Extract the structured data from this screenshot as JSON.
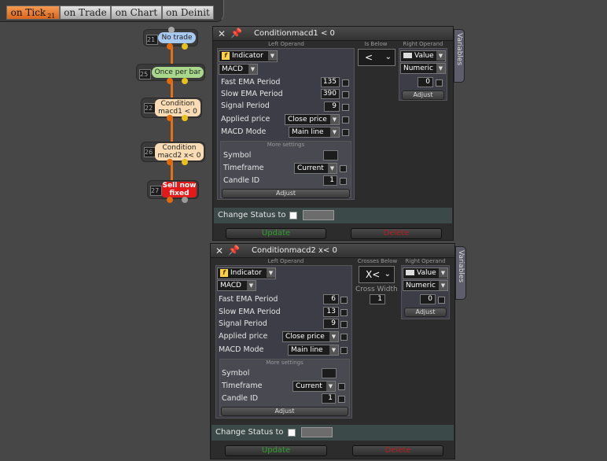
{
  "tabs": [
    {
      "label": "on Tick",
      "sub": "21"
    },
    {
      "label": "on Trade"
    },
    {
      "label": "on Chart"
    },
    {
      "label": "on Deinit"
    }
  ],
  "nodes": [
    {
      "num": "21",
      "label": "No trade"
    },
    {
      "num": "25",
      "label": "Once per bar"
    },
    {
      "num": "22",
      "label": "Condition macd1 < 0"
    },
    {
      "num": "26",
      "label": "Condition macd2 x< 0"
    },
    {
      "num": "27",
      "label": "Sell now fixed"
    }
  ],
  "panel1": {
    "title": "Conditionmacd1 < 0",
    "variables": "Variables",
    "left_operand": "Left Operand",
    "indicator_type": "Indicator",
    "indicator": "MACD",
    "params": [
      {
        "label": "Fast EMA Period",
        "value": "135"
      },
      {
        "label": "Slow EMA Period",
        "value": "390"
      },
      {
        "label": "Signal Period",
        "value": "9"
      }
    ],
    "applied_price_label": "Applied price",
    "applied_price": "Close price",
    "mode_label": "MACD Mode",
    "mode": "Main line",
    "more": "More settings",
    "symbol_label": "Symbol",
    "timeframe_label": "Timeframe",
    "timeframe": "Current",
    "candle_label": "Candle ID",
    "candle": "1",
    "adjust": "Adjust",
    "operator_label": "Is Below",
    "operator": "<",
    "right_operand": "Right Operand",
    "right_type": "Value",
    "right_format": "Numeric",
    "right_value": "0",
    "right_adjust": "Adjust",
    "status_label": "Change Status to",
    "update": "Update",
    "delete": "Delete"
  },
  "panel2": {
    "title": "Conditionmacd2 x< 0",
    "variables": "Variables",
    "left_operand": "Left Operand",
    "indicator_type": "Indicator",
    "indicator": "MACD",
    "params": [
      {
        "label": "Fast EMA Period",
        "value": "6"
      },
      {
        "label": "Slow EMA Period",
        "value": "13"
      },
      {
        "label": "Signal Period",
        "value": "9"
      }
    ],
    "applied_price_label": "Applied price",
    "applied_price": "Close price",
    "mode_label": "MACD Mode",
    "mode": "Main line",
    "more": "More settings",
    "symbol_label": "Symbol",
    "timeframe_label": "Timeframe",
    "timeframe": "Current",
    "candle_label": "Candle ID",
    "candle": "1",
    "adjust": "Adjust",
    "operator_label": "Crosses Below",
    "operator": "X<",
    "cross_width_label": "Cross Width",
    "cross_width": "1",
    "right_operand": "Right Operand",
    "right_type": "Value",
    "right_format": "Numeric",
    "right_value": "0",
    "right_adjust": "Adjust",
    "status_label": "Change Status to",
    "update": "Update",
    "delete": "Delete"
  }
}
